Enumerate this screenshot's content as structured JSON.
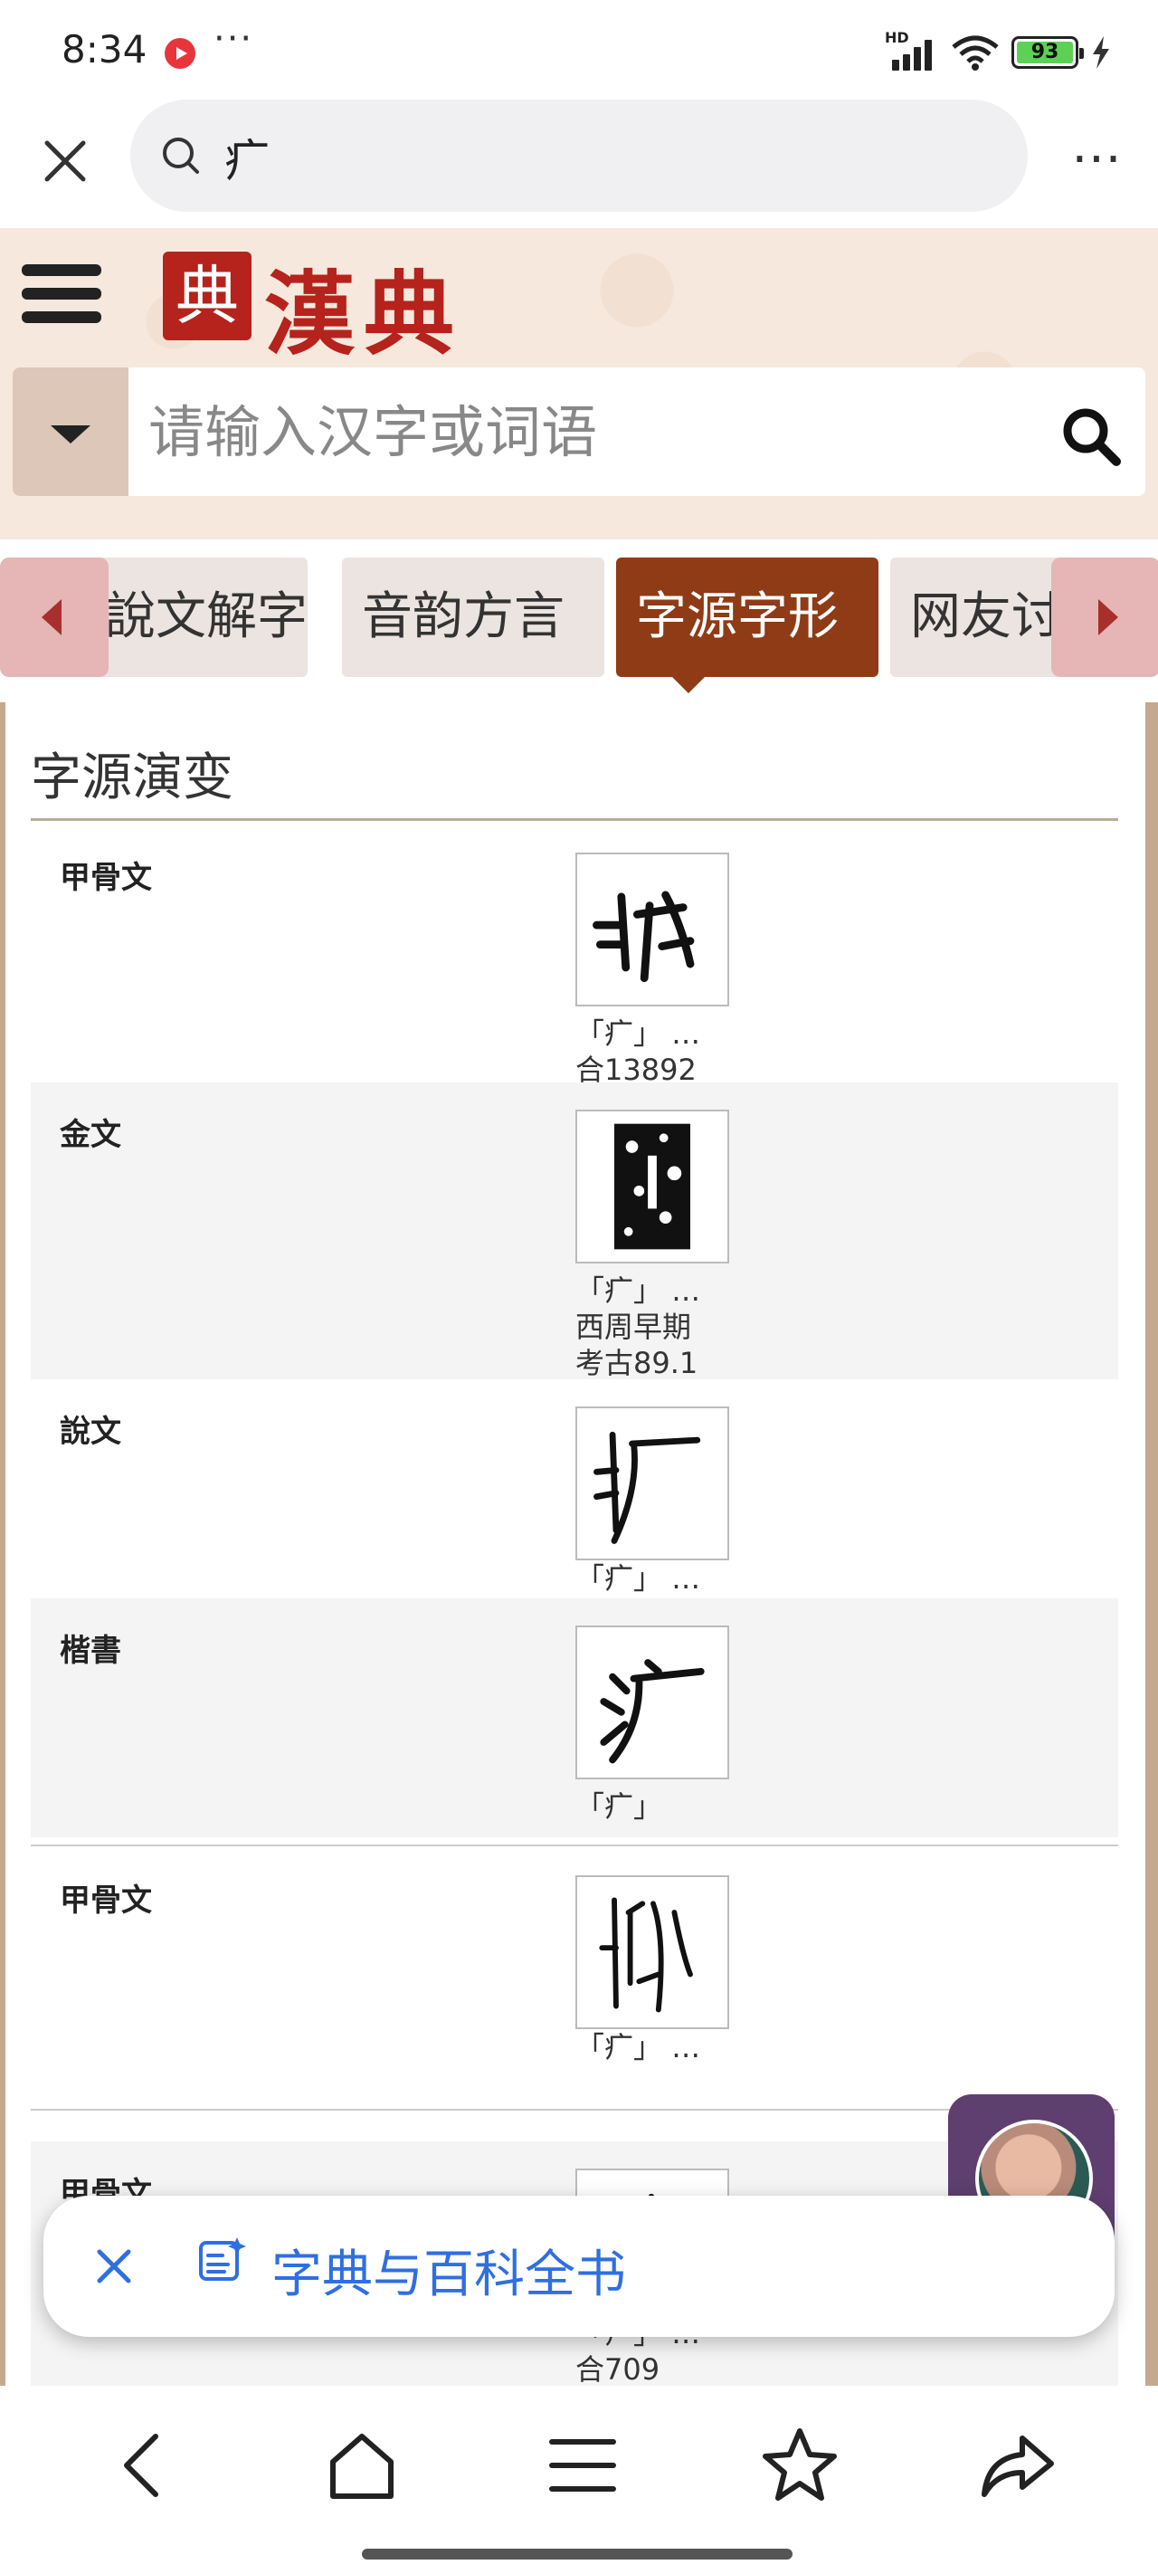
{
  "status_bar": {
    "time": "8:34",
    "network_badge": "HD",
    "battery": "93"
  },
  "browser": {
    "query": "疒"
  },
  "site": {
    "logo_seal": "典",
    "logo_text": "漢典",
    "search_placeholder": "请输入汉字或词语",
    "brand_color": "#b5231c",
    "accent_color": "#8f3b16"
  },
  "tabs": [
    {
      "label": "說文解字"
    },
    {
      "label": "音韵方言"
    },
    {
      "label": "字源字形",
      "active": true
    },
    {
      "label": "网友讨"
    }
  ],
  "section": {
    "title": "字源演变",
    "rows": [
      {
        "label": "甲骨文",
        "caption": "「疒」 …\n合13892"
      },
      {
        "label": "金文",
        "caption": "「疒」 …\n西周早期\n考古89.1"
      },
      {
        "label": "說文",
        "caption": "「疒」 …"
      },
      {
        "label": "楷書",
        "caption": "「疒」"
      },
      {
        "label": "甲骨文",
        "caption": "「疒」 …"
      },
      {
        "label": "甲骨文",
        "caption": "「疒」 …\n合709"
      }
    ]
  },
  "assistant": {
    "label": "字典与百科全书"
  },
  "icons": {
    "close": "close-icon",
    "search": "search-icon",
    "more": "more-icon",
    "menu": "hamburger-menu-icon",
    "dropdown": "chevron-down-icon",
    "nav": [
      "back-icon",
      "home-icon",
      "tabs-icon",
      "star-icon",
      "share-icon"
    ]
  }
}
